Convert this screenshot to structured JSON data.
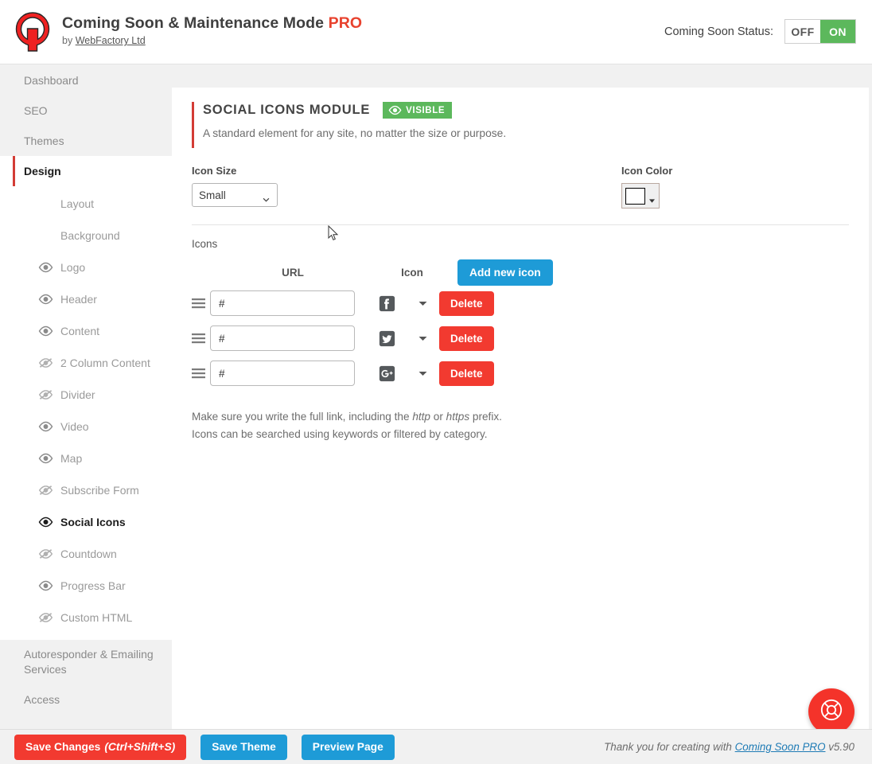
{
  "header": {
    "logo_icon": "wrench-logo-icon",
    "title_main": "Coming Soon & Maintenance Mode",
    "title_pro": "PRO",
    "byline_prefix": "by",
    "byline_link": "WebFactory Ltd",
    "status_label": "Coming Soon Status:",
    "toggle_off": "OFF",
    "toggle_on": "ON",
    "toggle_state": "ON",
    "accent_green": "#5cb85c",
    "accent_red": "#e8422e"
  },
  "sidebar": {
    "top_items": [
      {
        "label": "Dashboard"
      },
      {
        "label": "SEO"
      },
      {
        "label": "Themes"
      }
    ],
    "active_item": {
      "label": "Design"
    },
    "sub_items": [
      {
        "label": "Layout",
        "icon": "none"
      },
      {
        "label": "Background",
        "icon": "none"
      },
      {
        "label": "Logo",
        "icon": "eye-icon"
      },
      {
        "label": "Header",
        "icon": "eye-icon"
      },
      {
        "label": "Content",
        "icon": "eye-icon"
      },
      {
        "label": "2 Column Content",
        "icon": "eye-slash-icon"
      },
      {
        "label": "Divider",
        "icon": "eye-slash-icon"
      },
      {
        "label": "Video",
        "icon": "eye-icon"
      },
      {
        "label": "Map",
        "icon": "eye-icon"
      },
      {
        "label": "Subscribe Form",
        "icon": "eye-slash-icon"
      },
      {
        "label": "Social Icons",
        "icon": "eye-icon",
        "current": true
      },
      {
        "label": "Countdown",
        "icon": "eye-slash-icon"
      },
      {
        "label": "Progress Bar",
        "icon": "eye-icon"
      },
      {
        "label": "Custom HTML",
        "icon": "eye-slash-icon"
      }
    ],
    "bottom_items": [
      {
        "label": "Autoresponder & Emailing Services"
      },
      {
        "label": "Access"
      }
    ]
  },
  "module": {
    "title": "SOCIAL ICONS MODULE",
    "badge_label": "VISIBLE",
    "badge_icon": "eye-icon",
    "description": "A standard element for any site, no matter the size or purpose.",
    "icon_size_label": "Icon Size",
    "icon_size_value": "Small",
    "icon_color_label": "Icon Color",
    "icon_color_value": "#ffffff",
    "icons_section_label": "Icons",
    "col_url": "URL",
    "col_icon": "Icon",
    "add_button": "Add new icon",
    "rows": [
      {
        "url": "#",
        "icon": "facebook-square-icon",
        "delete_label": "Delete"
      },
      {
        "url": "#",
        "icon": "twitter-square-icon",
        "delete_label": "Delete"
      },
      {
        "url": "#",
        "icon": "google-plus-square-icon",
        "delete_label": "Delete"
      }
    ],
    "note_line1_a": "Make sure you write the full link, including the ",
    "note_line1_http": "http",
    "note_line1_b": " or ",
    "note_line1_https": "https",
    "note_line1_c": " prefix.",
    "note_line2": "Icons can be searched using keywords or filtered by category."
  },
  "footer": {
    "save_changes": "Save Changes",
    "save_changes_shortcut": "(Ctrl+Shift+S)",
    "save_theme": "Save Theme",
    "preview_page": "Preview Page",
    "credit_prefix": "Thank you for creating with",
    "credit_link": "Coming Soon PRO",
    "credit_version": "v5.90"
  },
  "support": {
    "icon": "life-ring-icon",
    "color": "#f4332a"
  }
}
